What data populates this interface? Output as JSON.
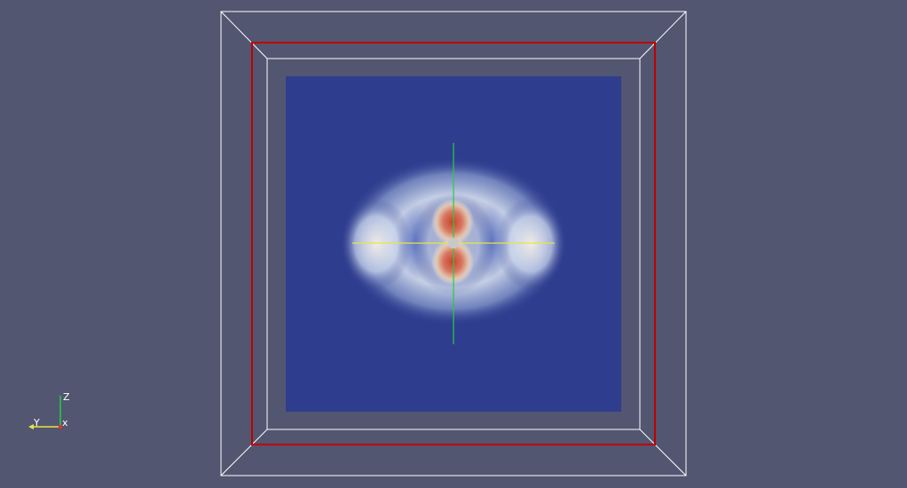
{
  "viewport": {
    "background": "#525670",
    "outline_color": "#ffffff",
    "selection_box_color": "#c00000",
    "slice_background": "#2f3d8f"
  },
  "widget": {
    "horizontal_line_color": "#e6e640",
    "vertical_line_color": "#20d040",
    "center_handle_color": "#c8c8c8"
  },
  "orientation_axes": {
    "z_label": "Z",
    "y_label": "Y",
    "x_label": "x",
    "z_color": "#20d040",
    "y_color": "#e6e640",
    "x_color": "#e03030"
  }
}
